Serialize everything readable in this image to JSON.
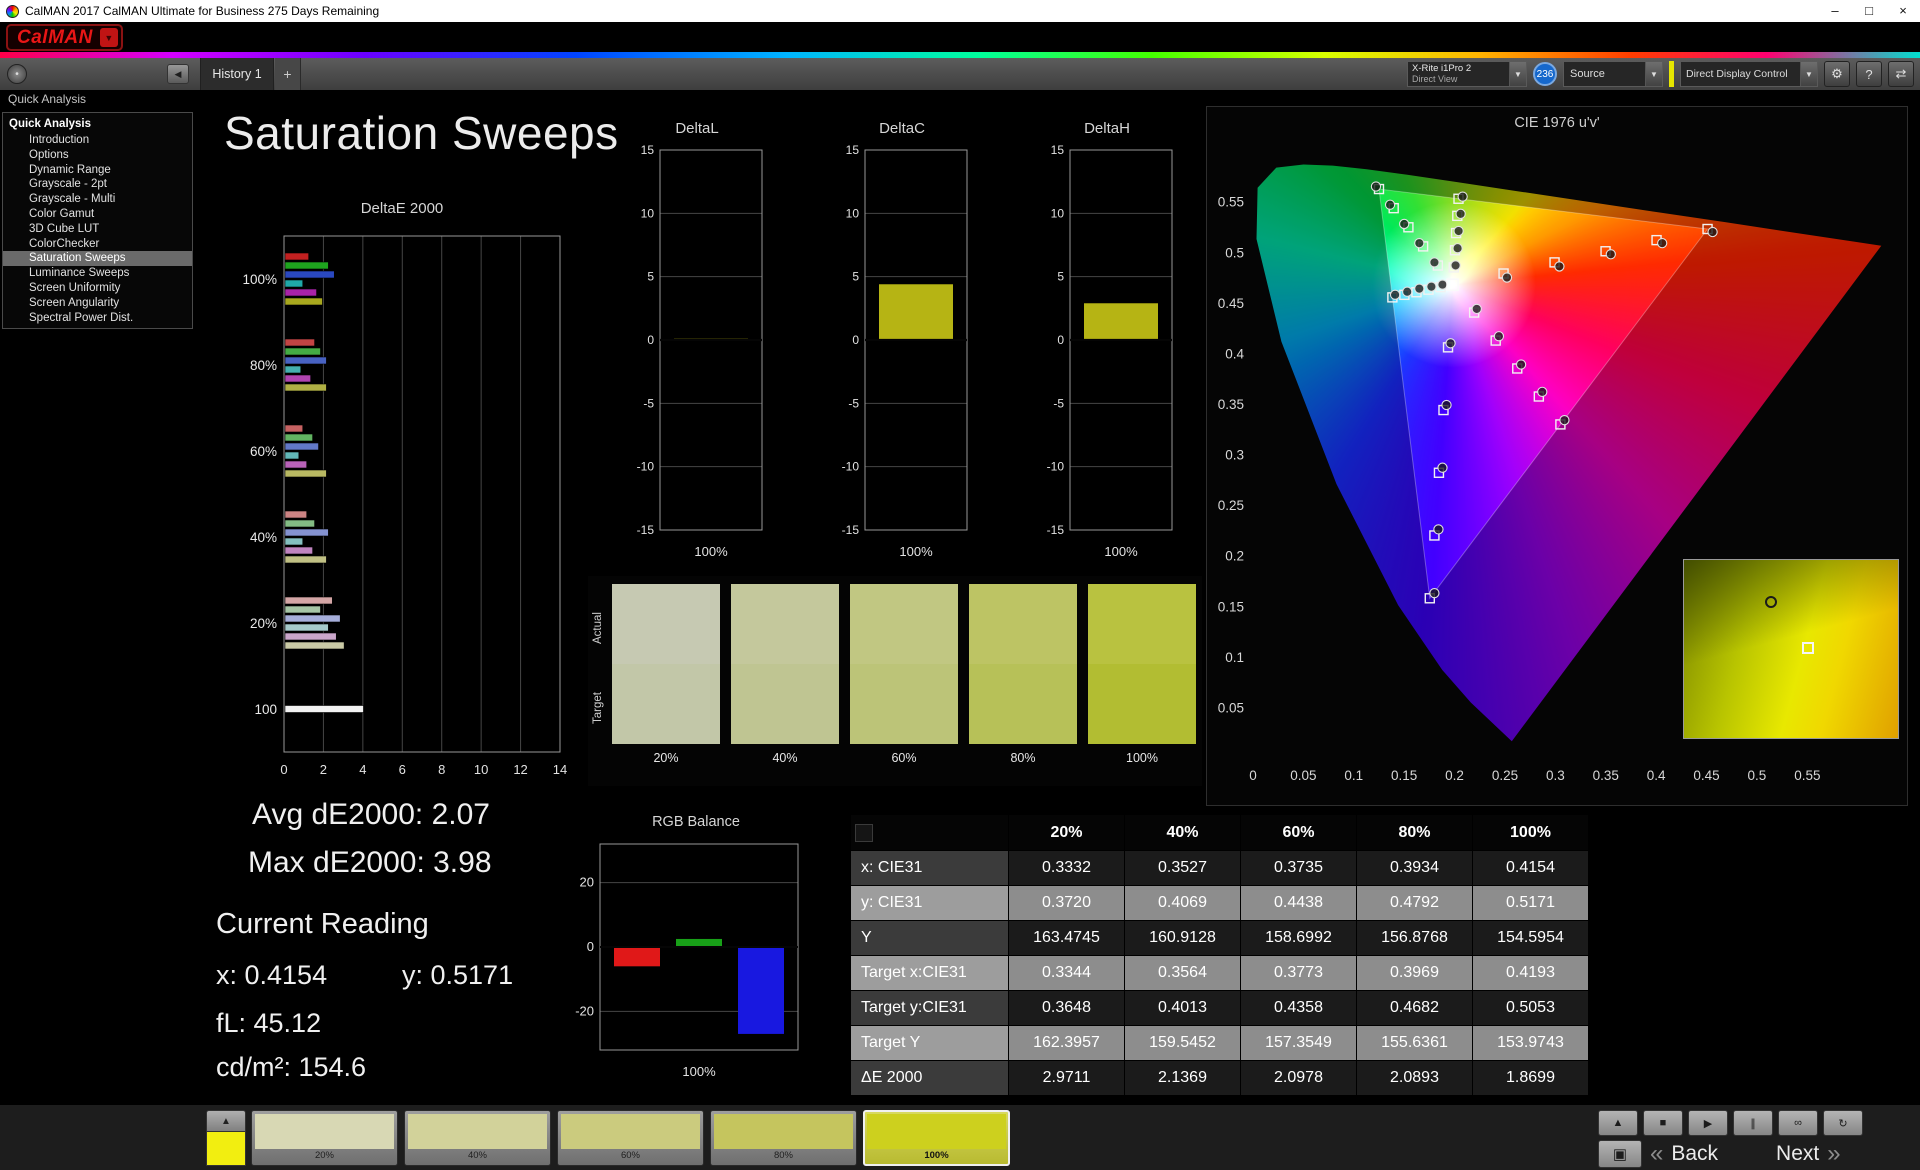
{
  "window": {
    "title": "CalMAN 2017 CalMAN Ultimate for Business 275 Days Remaining"
  },
  "brand": {
    "logo": "CalMAN"
  },
  "tabs": {
    "history": "History 1"
  },
  "toolbar": {
    "meter_line1": "X-Rite i1Pro 2",
    "meter_line2": "Direct View",
    "badge": "236",
    "source_label": "Source",
    "display_control_label": "Direct Display Control"
  },
  "icons": {
    "dropdown": "▼",
    "logo_arrow": "▼",
    "collapse": "◀",
    "dot": "•",
    "gear": "⚙",
    "help": "?",
    "swap": "⇄",
    "eject": "▲",
    "stop": "■",
    "play": "▶",
    "pause": "∥",
    "loop": "∞",
    "refresh": "↻",
    "frame": "▣",
    "back_chevrons": "«",
    "next_chevrons": "»",
    "minimize": "–",
    "maximize": "□",
    "close": "×",
    "tab_add": "+"
  },
  "sidebar": {
    "panel_title": "Quick Analysis",
    "root": "Quick Analysis",
    "items": [
      "Introduction",
      "Options",
      "Dynamic Range",
      "Grayscale - 2pt",
      "Grayscale - Multi",
      "Color Gamut",
      "3D Cube LUT",
      "ColorChecker",
      "Saturation Sweeps",
      "Luminance Sweeps",
      "Screen Uniformity",
      "Screen Angularity",
      "Spectral Power Dist."
    ],
    "selected": "Saturation Sweeps"
  },
  "page": {
    "title": "Saturation Sweeps"
  },
  "stats": {
    "avg": "Avg dE2000: 2.07",
    "max": "Max dE2000: 3.98",
    "current_reading": "Current Reading",
    "x": "x: 0.4154",
    "y": "y: 0.5171",
    "fl": "fL: 45.12",
    "cdm2": "cd/m²: 154.6"
  },
  "swatch_panel": {
    "row_labels": [
      "Actual",
      "Target"
    ],
    "items": [
      {
        "label": "20%",
        "actual": "#c6c9b2",
        "target": "#c2c7a8"
      },
      {
        "label": "40%",
        "actual": "#c4c89c",
        "target": "#bfc592"
      },
      {
        "label": "60%",
        "actual": "#c1c782",
        "target": "#bcc478"
      },
      {
        "label": "80%",
        "actual": "#bdc464",
        "target": "#b7c158"
      },
      {
        "label": "100%",
        "actual": "#b9c240",
        "target": "#b2bd32"
      }
    ]
  },
  "table": {
    "columns": [
      "",
      "20%",
      "40%",
      "60%",
      "80%",
      "100%"
    ],
    "rows": [
      {
        "label": "x: CIE31",
        "values": [
          "0.3332",
          "0.3527",
          "0.3735",
          "0.3934",
          "0.4154"
        ]
      },
      {
        "label": "y: CIE31",
        "values": [
          "0.3720",
          "0.4069",
          "0.4438",
          "0.4792",
          "0.5171"
        ]
      },
      {
        "label": "Y",
        "values": [
          "163.4745",
          "160.9128",
          "158.6992",
          "156.8768",
          "154.5954"
        ]
      },
      {
        "label": "Target x:CIE31",
        "values": [
          "0.3344",
          "0.3564",
          "0.3773",
          "0.3969",
          "0.4193"
        ]
      },
      {
        "label": "Target y:CIE31",
        "values": [
          "0.3648",
          "0.4013",
          "0.4358",
          "0.4682",
          "0.5053"
        ]
      },
      {
        "label": "Target Y",
        "values": [
          "162.3957",
          "159.5452",
          "157.3549",
          "155.6361",
          "153.9743"
        ]
      },
      {
        "label": "ΔE 2000",
        "values": [
          "2.9711",
          "2.1369",
          "2.0978",
          "2.0893",
          "1.8699"
        ]
      }
    ]
  },
  "bottom": {
    "back": "Back",
    "next": "Next",
    "eject_swatch_color": "#f2ee10",
    "transport": [
      "eject",
      "stop",
      "play",
      "pause",
      "loop",
      "refresh"
    ],
    "levels": [
      {
        "label": "20%",
        "color": "#d8d8b4",
        "active": false
      },
      {
        "label": "40%",
        "color": "#d2d29a",
        "active": false
      },
      {
        "label": "60%",
        "color": "#cbcb7e",
        "active": false
      },
      {
        "label": "80%",
        "color": "#c5c55e",
        "active": false
      },
      {
        "label": "100%",
        "color": "#cdd01e",
        "active": true
      }
    ]
  },
  "chart_data": [
    {
      "id": "deltae2000",
      "type": "bar",
      "orientation": "horizontal",
      "title": "DeltaE 2000",
      "xlim": [
        0,
        14
      ],
      "xticks": [
        0,
        2,
        4,
        6,
        8,
        10,
        12,
        14
      ],
      "groups": [
        {
          "label": "100%",
          "bars": [
            {
              "color": "#c22020",
              "value": 1.2
            },
            {
              "color": "#1ea41e",
              "value": 2.2
            },
            {
              "color": "#2a48c0",
              "value": 2.5
            },
            {
              "color": "#1fa8a8",
              "value": 0.9
            },
            {
              "color": "#a822a8",
              "value": 1.6
            },
            {
              "color": "#a8a81e",
              "value": 1.9
            }
          ]
        },
        {
          "label": "80%",
          "bars": [
            {
              "color": "#c24444",
              "value": 1.5
            },
            {
              "color": "#44ac44",
              "value": 1.8
            },
            {
              "color": "#4862c2",
              "value": 2.1
            },
            {
              "color": "#44b0b0",
              "value": 0.8
            },
            {
              "color": "#b044b0",
              "value": 1.3
            },
            {
              "color": "#b0b044",
              "value": 2.1
            }
          ]
        },
        {
          "label": "60%",
          "bars": [
            {
              "color": "#c66262",
              "value": 0.9
            },
            {
              "color": "#62b462",
              "value": 1.4
            },
            {
              "color": "#6279c8",
              "value": 1.7
            },
            {
              "color": "#62b8b8",
              "value": 0.7
            },
            {
              "color": "#b862b8",
              "value": 1.1
            },
            {
              "color": "#b8b862",
              "value": 2.1
            }
          ]
        },
        {
          "label": "40%",
          "bars": [
            {
              "color": "#cc8484",
              "value": 1.1
            },
            {
              "color": "#84bc84",
              "value": 1.5
            },
            {
              "color": "#8492d0",
              "value": 2.2
            },
            {
              "color": "#84c0c0",
              "value": 0.9
            },
            {
              "color": "#c084c0",
              "value": 1.4
            },
            {
              "color": "#c0c084",
              "value": 2.1
            }
          ]
        },
        {
          "label": "20%",
          "bars": [
            {
              "color": "#d4a6a6",
              "value": 2.4
            },
            {
              "color": "#a6c6a6",
              "value": 1.8
            },
            {
              "color": "#a6aeda",
              "value": 2.8
            },
            {
              "color": "#a6caca",
              "value": 2.2
            },
            {
              "color": "#caa6ca",
              "value": 2.6
            },
            {
              "color": "#cacaa6",
              "value": 3.0
            }
          ]
        },
        {
          "label": "100",
          "bars": [
            {
              "color": "#f2f2f2",
              "value": 3.98
            }
          ]
        }
      ]
    },
    {
      "id": "deltaL",
      "type": "bar",
      "title": "DeltaL",
      "ylim": [
        -15,
        15
      ],
      "yticks": [
        15,
        10,
        5,
        0,
        -5,
        -10,
        -15
      ],
      "xlabel": "100%",
      "values": [
        {
          "color": "#b6b414",
          "value": 0.1
        }
      ]
    },
    {
      "id": "deltaC",
      "type": "bar",
      "title": "DeltaC",
      "ylim": [
        -15,
        15
      ],
      "yticks": [
        15,
        10,
        5,
        0,
        -5,
        -10,
        -15
      ],
      "xlabel": "100%",
      "values": [
        {
          "color": "#b6b414",
          "value": 4.4
        }
      ]
    },
    {
      "id": "deltaH",
      "type": "bar",
      "title": "DeltaH",
      "ylim": [
        -15,
        15
      ],
      "yticks": [
        15,
        10,
        5,
        0,
        -5,
        -10,
        -15
      ],
      "xlabel": "100%",
      "values": [
        {
          "color": "#b6b414",
          "value": 2.9
        }
      ]
    },
    {
      "id": "rgbbalance",
      "type": "bar",
      "title": "RGB Balance",
      "ylim": [
        -32,
        32
      ],
      "yticks": [
        20,
        0,
        -20
      ],
      "xlabel": "100%",
      "values": [
        {
          "name": "red",
          "color": "#e01818",
          "value": -6
        },
        {
          "name": "green",
          "color": "#18a018",
          "value": 2.5
        },
        {
          "name": "blue",
          "color": "#1818e0",
          "value": -27
        }
      ]
    },
    {
      "id": "cie1976",
      "type": "scatter",
      "title": "CIE 1976 u'v'",
      "xlim": [
        0,
        0.635
      ],
      "ylim": [
        0,
        0.61
      ],
      "xticks": [
        0,
        0.05,
        0.1,
        0.15,
        0.2,
        0.25,
        0.3,
        0.35,
        0.4,
        0.45,
        0.5,
        0.55
      ],
      "yticks": [
        0.05,
        0.1,
        0.15,
        0.2,
        0.25,
        0.3,
        0.35,
        0.4,
        0.45,
        0.5,
        0.55
      ],
      "white_point": [
        0.198,
        0.468
      ],
      "gamut_triangle": [
        [
          0.451,
          0.523
        ],
        [
          0.125,
          0.5625
        ],
        [
          0.1754,
          0.1579
        ]
      ],
      "sweeps": [
        {
          "name": "red",
          "targets": [
            [
              0.2486,
              0.479
            ],
            [
              0.2992,
              0.49
            ],
            [
              0.3498,
              0.501
            ],
            [
              0.4004,
              0.512
            ],
            [
              0.451,
              0.523
            ]
          ],
          "measured": [
            [
              0.252,
              0.475
            ],
            [
              0.304,
              0.486
            ],
            [
              0.355,
              0.498
            ],
            [
              0.406,
              0.509
            ],
            [
              0.456,
              0.52
            ]
          ]
        },
        {
          "name": "green",
          "targets": [
            [
              0.1834,
              0.4869
            ],
            [
              0.1688,
              0.5058
            ],
            [
              0.1542,
              0.5247
            ],
            [
              0.1396,
              0.5436
            ],
            [
              0.125,
              0.5625
            ]
          ],
          "measured": [
            [
              0.18,
              0.49
            ],
            [
              0.165,
              0.509
            ],
            [
              0.15,
              0.528
            ],
            [
              0.136,
              0.547
            ],
            [
              0.122,
              0.565
            ]
          ]
        },
        {
          "name": "blue",
          "targets": [
            [
              0.1935,
              0.406
            ],
            [
              0.189,
              0.344
            ],
            [
              0.1845,
              0.282
            ],
            [
              0.18,
              0.22
            ],
            [
              0.1754,
              0.1579
            ]
          ],
          "measured": [
            [
              0.196,
              0.41
            ],
            [
              0.192,
              0.349
            ],
            [
              0.188,
              0.287
            ],
            [
              0.184,
              0.226
            ],
            [
              0.18,
              0.163
            ]
          ]
        },
        {
          "name": "cyan",
          "targets": [
            [
              0.1861,
              0.4655
            ],
            [
              0.1741,
              0.463
            ],
            [
              0.1622,
              0.4605
            ],
            [
              0.1502,
              0.4579
            ],
            [
              0.1383,
              0.4554
            ]
          ],
          "measured": [
            [
              0.188,
              0.468
            ],
            [
              0.177,
              0.466
            ],
            [
              0.165,
              0.464
            ],
            [
              0.153,
              0.461
            ],
            [
              0.141,
              0.458
            ]
          ]
        },
        {
          "name": "magenta",
          "targets": [
            [
              0.2194,
              0.4404
            ],
            [
              0.2408,
              0.4127
            ],
            [
              0.2622,
              0.3851
            ],
            [
              0.2836,
              0.3574
            ],
            [
              0.305,
              0.3298
            ]
          ],
          "measured": [
            [
              0.222,
              0.444
            ],
            [
              0.244,
              0.417
            ],
            [
              0.266,
              0.389
            ],
            [
              0.287,
              0.362
            ],
            [
              0.309,
              0.334
            ]
          ]
        },
        {
          "name": "yellow",
          "targets": [
            [
              0.1992,
              0.485
            ],
            [
              0.2004,
              0.502
            ],
            [
              0.2015,
              0.519
            ],
            [
              0.2027,
              0.536
            ],
            [
              0.2039,
              0.5529
            ]
          ],
          "measured": [
            [
              0.201,
              0.487
            ],
            [
              0.203,
              0.504
            ],
            [
              0.204,
              0.521
            ],
            [
              0.206,
              0.538
            ],
            [
              0.208,
              0.555
            ]
          ]
        }
      ]
    }
  ]
}
